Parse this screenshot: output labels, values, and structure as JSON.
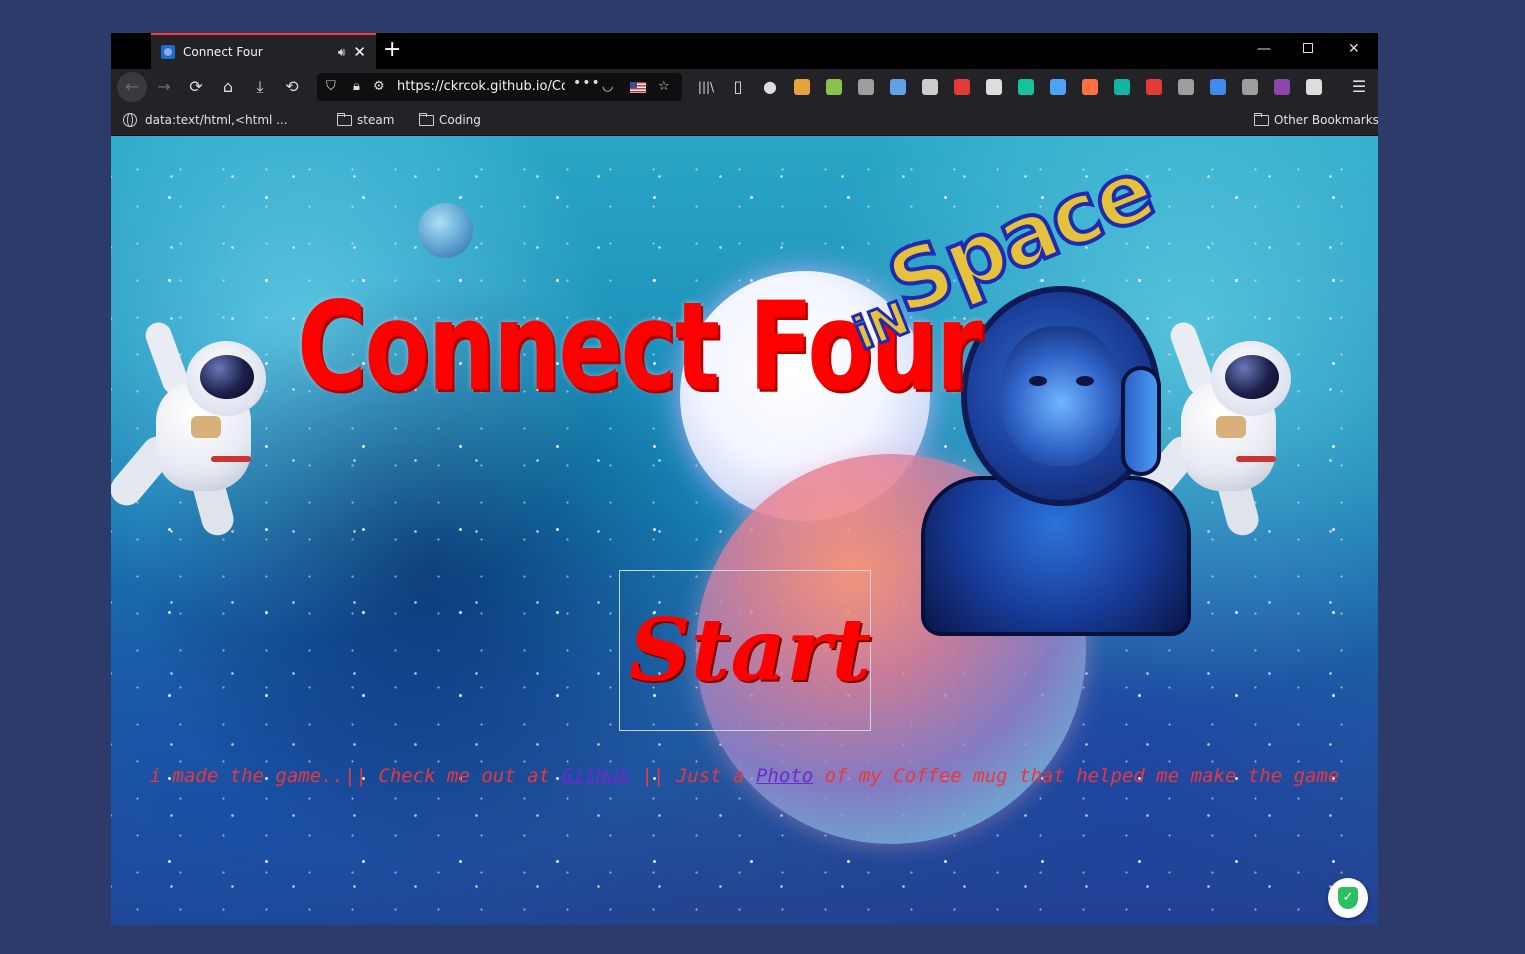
{
  "browser": {
    "tab": {
      "title": "Connect Four",
      "audio_icon": "speaker-icon",
      "close_glyph": "✕"
    },
    "newtab_glyph": "+",
    "window_controls": {
      "minimize": "—",
      "maximize": "",
      "close": "✕"
    },
    "nav": {
      "back": "←",
      "forward": "→",
      "reload": "⟳",
      "home": "⌂",
      "download": "⤓",
      "history": "⟲",
      "url": "https://ckrcok.github.io/Connect-Four",
      "url_menu": "•••",
      "library": "|||\\",
      "sidebar": "▯",
      "account": "●",
      "menu": "☰"
    },
    "extensions": [
      {
        "name": "extension-owl-icon",
        "color": "#e8a23a"
      },
      {
        "name": "extension-chat-icon",
        "color": "#8bc34a"
      },
      {
        "name": "extension-translate-icon",
        "color": "#9e9e9e"
      },
      {
        "name": "extension-camera-icon",
        "color": "#5fa3e6"
      },
      {
        "name": "extension-tool-icon",
        "color": "#cccccc"
      },
      {
        "name": "extension-tomato-icon",
        "color": "#e53935"
      },
      {
        "name": "extension-piano-icon",
        "color": "#dddddd"
      },
      {
        "name": "extension-grammarly-icon",
        "color": "#15c39a"
      },
      {
        "name": "extension-cloud-icon",
        "color": "#4fa3f7"
      },
      {
        "name": "extension-megaphone-icon",
        "color": "#ff7043"
      },
      {
        "name": "extension-a-icon",
        "color": "#12b5a3"
      },
      {
        "name": "extension-pen-icon",
        "color": "#e53935"
      },
      {
        "name": "extension-gray-circle-icon",
        "color": "#9e9e9e"
      },
      {
        "name": "extension-iq-icon",
        "color": "#3f8bf0"
      },
      {
        "name": "extension-ring-icon",
        "color": "#9e9e9e"
      },
      {
        "name": "extension-grid-icon",
        "color": "#8e44ad"
      },
      {
        "name": "extension-react-icon",
        "color": "#dddddd"
      }
    ],
    "bookmarks": {
      "first": "data:text/html,<html ...",
      "items": [
        "steam",
        "Coding"
      ],
      "other": "Other Bookmarks"
    }
  },
  "page": {
    "logo": {
      "title": "Connect Four",
      "in_text": "iN",
      "space_text": "Space"
    },
    "start_label": "Start",
    "footer": {
      "part1": "i made the game..|| Check me out at ",
      "github_link": "GitHub",
      "part2": " || Just a ",
      "photo_link": "Photo",
      "part3": " of my Coffee mug that helped me make the game"
    },
    "badge_glyph": "✓"
  }
}
